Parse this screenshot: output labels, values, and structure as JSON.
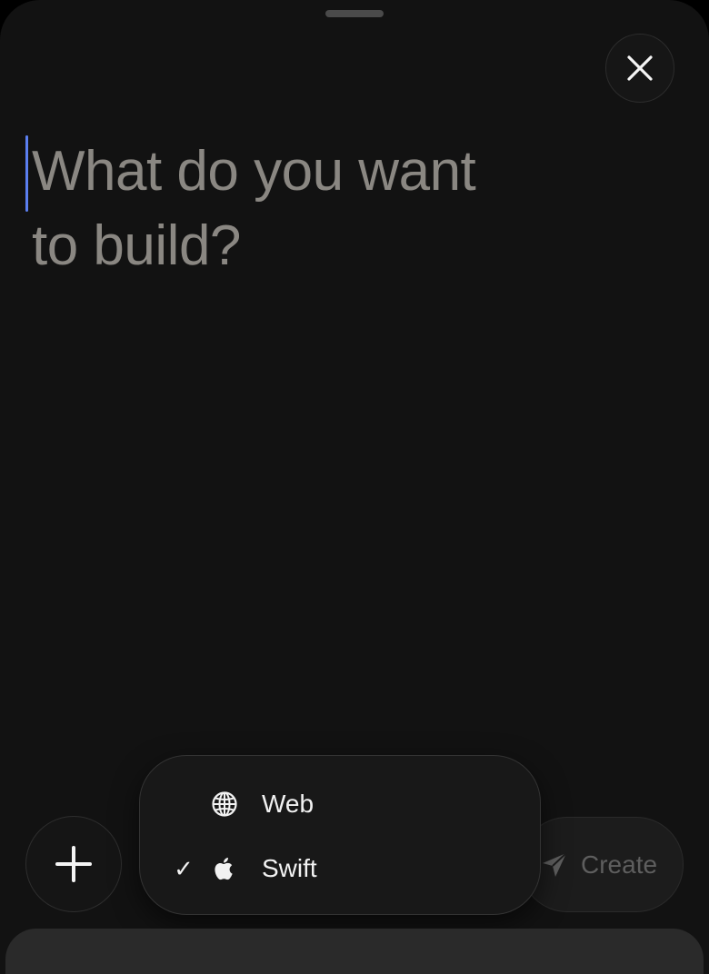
{
  "prompt": {
    "placeholder_line1": "What do you want",
    "placeholder_line2": "to build?"
  },
  "header": {
    "close_icon": "close-icon"
  },
  "toolbar": {
    "add_icon": "plus-icon",
    "create_label": "Create",
    "create_icon": "paper-plane-icon"
  },
  "platform_menu": {
    "items": [
      {
        "label": "Web",
        "icon": "globe-icon",
        "selected": false
      },
      {
        "label": "Swift",
        "icon": "apple-icon",
        "selected": true,
        "check": "✓"
      }
    ]
  },
  "colors": {
    "background": "#121212",
    "caret": "#5b7ff0",
    "placeholder": "#8a8782",
    "menu_text": "#f2f2f2",
    "create_disabled": "#5e5e5e"
  }
}
